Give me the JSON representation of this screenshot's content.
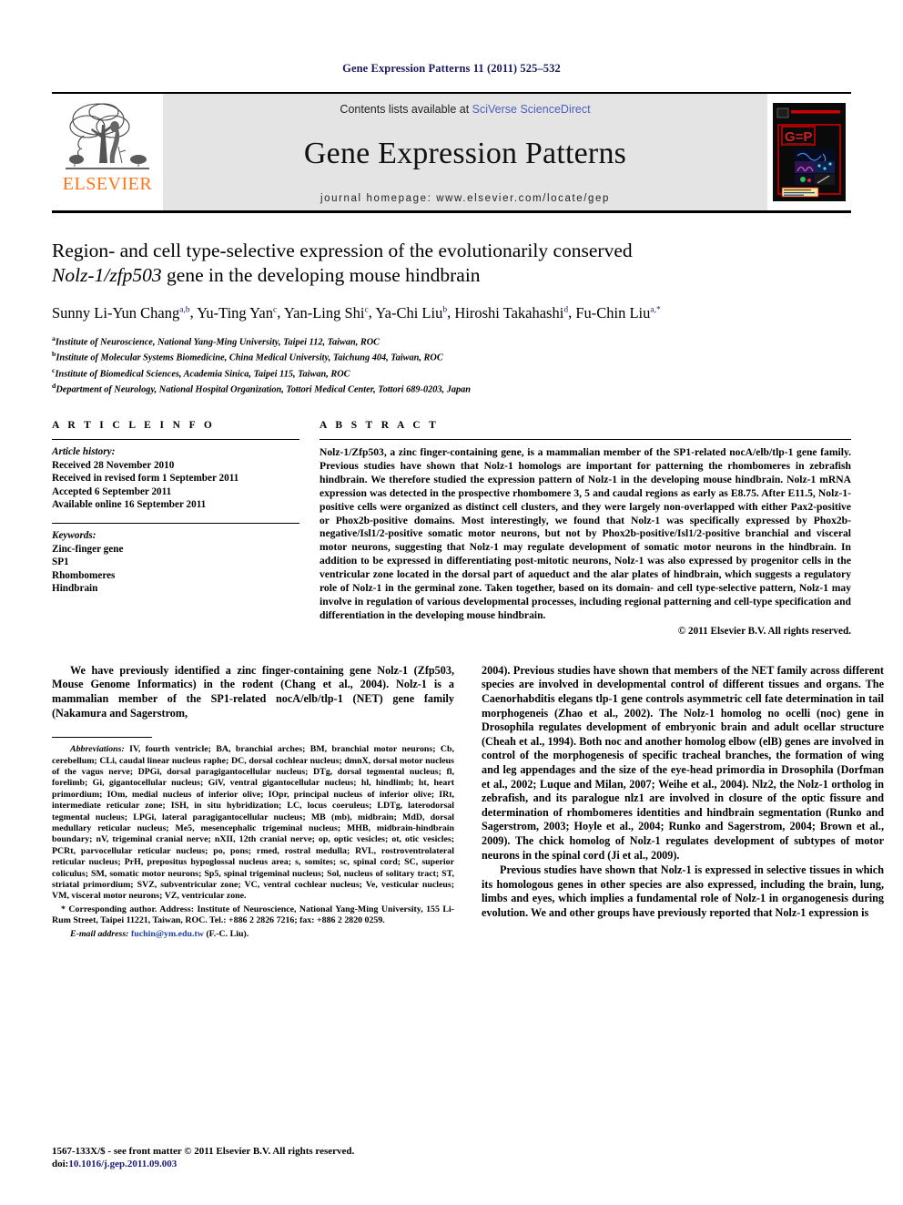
{
  "running_head": "Gene Expression Patterns 11 (2011) 525–532",
  "masthead": {
    "publisher_name": "ELSEVIER",
    "publisher_logo_icon": "elsevier-tree-icon",
    "contents_prefix": "Contents lists available at ",
    "contents_link": "SciVerse ScienceDirect",
    "journal_name": "Gene Expression Patterns",
    "homepage_line": "journal homepage: www.elsevier.com/locate/gep",
    "cover_icon": "journal-cover-thumbnail",
    "cover_title": "GEP"
  },
  "article": {
    "title_line1": "Region- and cell type-selective expression of the evolutionarily conserved",
    "title_italic": "Nolz-1/zfp503",
    "title_line2_rest": " gene in the developing mouse hindbrain",
    "authors": [
      {
        "name": "Sunny Li-Yun Chang",
        "sup": "a,b",
        "sep": ", "
      },
      {
        "name": "Yu-Ting Yan",
        "sup": "c",
        "sep": ", "
      },
      {
        "name": "Yan-Ling Shi",
        "sup": "c",
        "sep": ", "
      },
      {
        "name": "Ya-Chi Liu",
        "sup": "b",
        "sep": ", "
      },
      {
        "name": "Hiroshi Takahashi",
        "sup": "d",
        "sep": ", "
      },
      {
        "name": "Fu-Chin Liu",
        "sup": "a,*",
        "sep": ""
      }
    ],
    "affiliations": [
      {
        "mark": "a",
        "text": "Institute of Neuroscience, National Yang-Ming University, Taipei 112, Taiwan, ROC"
      },
      {
        "mark": "b",
        "text": "Institute of Molecular Systems Biomedicine, China Medical University, Taichung 404, Taiwan, ROC"
      },
      {
        "mark": "c",
        "text": "Institute of Biomedical Sciences, Academia Sinica, Taipei 115, Taiwan, ROC"
      },
      {
        "mark": "d",
        "text": "Department of Neurology, National Hospital Organization, Tottori Medical Center, Tottori 689-0203, Japan"
      }
    ]
  },
  "article_info": {
    "heading": "A R T I C L E    I N F O",
    "history_label": "Article history:",
    "history": [
      "Received 28 November 2010",
      "Received in revised form 1 September 2011",
      "Accepted 6 September 2011",
      "Available online 16 September 2011"
    ],
    "keywords_label": "Keywords:",
    "keywords": [
      "Zinc-finger gene",
      "SP1",
      "Rhombomeres",
      "Hindbrain"
    ]
  },
  "abstract": {
    "heading": "A B S T R A C T",
    "text": "Nolz-1/Zfp503, a zinc finger-containing gene, is a mammalian member of the SP1-related nocA/elb/tlp-1 gene family. Previous studies have shown that Nolz-1 homologs are important for patterning the rhombomeres in zebrafish hindbrain. We therefore studied the expression pattern of Nolz-1 in the developing mouse hindbrain. Nolz-1 mRNA expression was detected in the prospective rhombomere 3, 5 and caudal regions as early as E8.75. After E11.5, Nolz-1-positive cells were organized as distinct cell clusters, and they were largely non-overlapped with either Pax2-positive or Phox2b-positive domains. Most interestingly, we found that Nolz-1 was specifically expressed by Phox2b-negative/Isl1/2-positive somatic motor neurons, but not by Phox2b-positive/Isl1/2-positive branchial and visceral motor neurons, suggesting that Nolz-1 may regulate development of somatic motor neurons in the hindbrain. In addition to be expressed in differentiating post-mitotic neurons, Nolz-1 was also expressed by progenitor cells in the ventricular zone located in the dorsal part of aqueduct and the alar plates of hindbrain, which suggests a regulatory role of Nolz-1 in the germinal zone. Taken together, based on its domain- and cell type-selective pattern, Nolz-1 may involve in regulation of various developmental processes, including regional patterning and cell-type specification and differentiation in the developing mouse hindbrain.",
    "copyright": "© 2011 Elsevier B.V. All rights reserved."
  },
  "body": {
    "left_paragraph_text": "We have previously identified a zinc finger-containing gene Nolz-1 (Zfp503, Mouse Genome Informatics) in the rodent (Chang et al., 2004). Nolz-1 is a mammalian member of the SP1-related nocA/elb/tlp-1 (NET) gene family (Nakamura and Sagerstrom,",
    "right_paragraph_1": "2004). Previous studies have shown that members of the NET family across different species are involved in developmental control of different tissues and organs. The Caenorhabditis elegans tlp-1 gene controls asymmetric cell fate determination in tail morphogeneis (Zhao et al., 2002). The Nolz-1 homolog no ocelli (noc) gene in Drosophila regulates development of embryonic brain and adult ocellar structure (Cheah et al., 1994). Both noc and another homolog elbow (elB) genes are involved in control of the morphogenesis of specific tracheal branches, the formation of wing and leg appendages and the size of the eye-head primordia in Drosophila (Dorfman et al., 2002; Luque and Milan, 2007; Weihe et al., 2004). Nlz2, the Nolz-1 ortholog in zebrafish, and its paralogue nlz1 are involved in closure of the optic fissure and determination of rhombomeres identities and hindbrain segmentation (Runko and Sagerstrom, 2003; Hoyle et al., 2004; Runko and Sagerstrom, 2004; Brown et al., 2009). The chick homolog of Nolz-1 regulates development of subtypes of motor neurons in the spinal cord (Ji et al., 2009).",
    "right_paragraph_2": "Previous studies have shown that Nolz-1 is expressed in selective tissues in which its homologous genes in other species are also expressed, including the brain, lung, limbs and eyes, which implies a fundamental role of Nolz-1 in organogenesis during evolution. We and other groups have previously reported that Nolz-1 expression is"
  },
  "footnotes": {
    "abbrev_label": "Abbreviations:",
    "abbrev_text": " IV, fourth ventricle; BA, branchial arches; BM, branchial motor neurons; Cb, cerebellum; CLi, caudal linear nucleus raphe; DC, dorsal cochlear nucleus; dmnX, dorsal motor nucleus of the vagus nerve; DPGi, dorsal paragigantocellular nucleus; DTg, dorsal tegmental nucleus; fl, forelimb; Gi, gigantocellular nucleus; GiV, ventral gigantocellular nucleus; hl, hindlimb; ht, heart primordium; IOm, medial nucleus of inferior olive; IOpr, principal nucleus of inferior olive; IRt, intermediate reticular zone; ISH, in situ hybridization; LC, locus coeruleus; LDTg, laterodorsal tegmental nucleus; LPGi, lateral paragigantocellular nucleus; MB (mb), midbrain; MdD, dorsal medullary reticular nucleus; Me5, mesencephalic trigeminal nucleus; MHB, midbrain-hindbrain boundary; nV, trigeminal cranial nerve; nXII, 12th cranial nerve; op, optic vesicles; ot, otic vesicles; PCRt, parvocellular reticular nucleus; po, pons; rmed, rostral medulla; RVL, rostroventrolateral reticular nucleus; PrH, prepositus hypoglossal nucleus area; s, somites; sc, spinal cord; SC, superior coliculus; SM, somatic motor neurons; Sp5, spinal trigeminal nucleus; Sol, nucleus of solitary tract; ST, striatal primordium; SVZ, subventricular zone; VC, ventral cochlear nucleus; Ve, vesticular nucleus; VM, visceral motor neurons; VZ, ventricular zone.",
    "corresponding_marker": "*",
    "corresponding_text": " Corresponding author. Address: Institute of Neuroscience, National Yang-Ming University, 155 Li-Rum Street, Taipei 11221, Taiwan, ROC. Tel.: +886 2 2826 7216; fax: +886 2 2820 0259.",
    "email_label": "E-mail address:",
    "email": "fuchin@ym.edu.tw",
    "email_suffix": " (F.-C. Liu)."
  },
  "page_footer": {
    "issn_line": "1567-133X/$ - see front matter © 2011 Elsevier B.V. All rights reserved.",
    "doi_label": "doi:",
    "doi_value": "10.1016/j.gep.2011.09.003"
  },
  "colors": {
    "link": "#4a5fbf",
    "citation": "#1c3fa0",
    "running_head": "#1a1a5e",
    "elsevier_orange": "#ff7518",
    "band_gray": "#e4e4e4"
  }
}
